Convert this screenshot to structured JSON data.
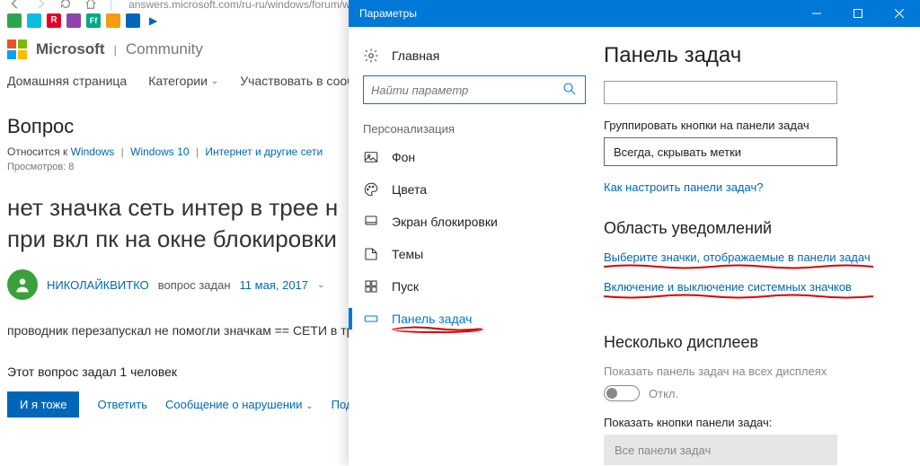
{
  "browser": {
    "url": "answers.microsoft.com/ru-ru/windows/forum/w"
  },
  "page": {
    "brand_ms": "Microsoft",
    "brand_sep": "|",
    "brand_comm": "Community",
    "nav_home": "Домашняя страница",
    "nav_categories": "Категории",
    "nav_participate": "Участвовать в сообщес",
    "q_label": "Вопрос",
    "meta_prefix": "Относится к",
    "meta_windows": "Windows",
    "meta_win10": "Windows 10",
    "meta_net": "Интернет и другие сети",
    "views": "Просмотров: 8",
    "title_l1": "нет значка сеть интер в трее н",
    "title_l2": "при вкл пк на окне блокировки",
    "author": "НИКОЛАЙКВИТКО",
    "asked": "вопрос задан",
    "date": "11 мая, 2017",
    "body": "проводник перезапускал не помогли значкам == СЕТИ в трее так",
    "helpful": "Этот вопрос задал 1 человек",
    "btn_metoo": "И я тоже",
    "link_reply": "Ответить",
    "link_report": "Сообщение о нарушении",
    "link_sub": "Подп"
  },
  "settings": {
    "window_title": "Параметры",
    "home": "Главная",
    "search_placeholder": "Найти параметр",
    "section": "Персонализация",
    "items": {
      "background": "Фон",
      "colors": "Цвета",
      "lockscreen": "Экран блокировки",
      "themes": "Темы",
      "start": "Пуск",
      "taskbar": "Панель задач"
    },
    "right": {
      "h1": "Панель задач",
      "group_label": "Группировать кнопки на панели задач",
      "group_value": "Всегда, скрывать метки",
      "howto": "Как настроить панели задач?",
      "h2_notif": "Область уведомлений",
      "link_icons": "Выберите значки, отображаемые в панели задач",
      "link_sysicons": "Включение и выключение системных значков",
      "h2_multi": "Несколько дисплеев",
      "multi_label": "Показать панель задач на всех дисплеях",
      "toggle_state": "Откл.",
      "show_buttons_label": "Показать кнопки панели задач:",
      "show_buttons_value": "Все панели задач"
    }
  }
}
